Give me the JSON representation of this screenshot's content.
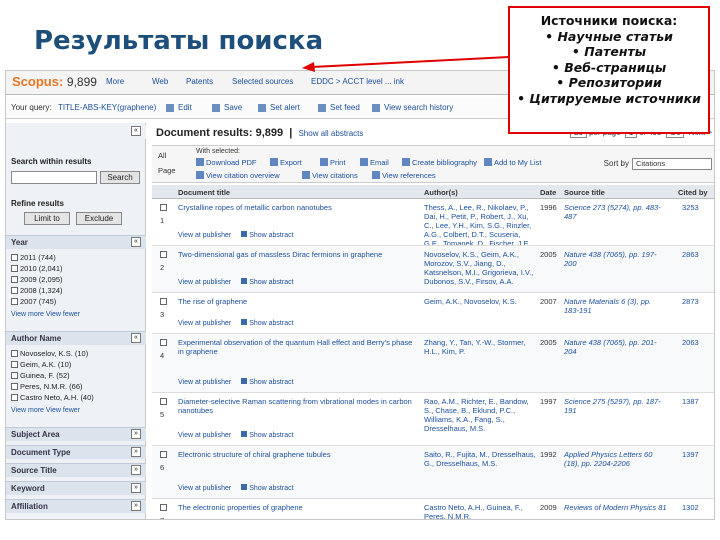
{
  "slide": {
    "title": "Результаты поиска",
    "callout": {
      "heading": "Источники поиска:",
      "items": [
        "• Научные статьи",
        "• Патенты",
        "• Веб-страницы",
        "• Репозитории",
        "• Цитируемые источники"
      ]
    }
  },
  "tabs": {
    "scopus_label": "Scopus:",
    "scopus_count": "9,899",
    "more": "More",
    "web": "Web",
    "patents": "Patents",
    "selected_sources": "Selected sources",
    "custom": "EDDC > ACCT level ... ink"
  },
  "query": {
    "label": "Your query:",
    "text": "TITLE-ABS-KEY(graphene)",
    "edit": "Edit",
    "save": "Save",
    "set_alert": "Set alert",
    "set_feed": "Set feed",
    "history": "View search history"
  },
  "sidebar": {
    "search_within": "Search within results",
    "search_btn": "Search",
    "refine": "Refine results",
    "limit_btn": "Limit to",
    "exclude_btn": "Exclude",
    "year": {
      "head": "Year",
      "items": [
        "2011 (744)",
        "2010 (2,041)",
        "2009 (2,095)",
        "2008 (1,324)",
        "2007 (745)"
      ],
      "more": "View more   View fewer"
    },
    "author": {
      "head": "Author Name",
      "items": [
        "Novoselov, K.S. (10)",
        "Geim, A.K. (10)",
        "Guinea, F. (52)",
        "Peres, N.M.R. (66)",
        "Castro Neto, A.H. (40)"
      ],
      "more": "View more   View fewer"
    },
    "collapsed": [
      "Subject Area",
      "Document Type",
      "Source Title",
      "Keyword",
      "Affiliation"
    ]
  },
  "main": {
    "results_title": "Document results: 9,899",
    "show_abstracts": "Show all abstracts",
    "pager": {
      "per_page": "20",
      "label": "per page",
      "page_box": "1",
      "of": "of 495",
      "go": "Go",
      "next": "Next >"
    },
    "toolbar": {
      "all": "All",
      "page": "Page",
      "with_selected": "With selected:",
      "download": "Download PDF",
      "export": "Export",
      "print": "Print",
      "email": "Email",
      "bibliography": "Create bibliography",
      "add_list": "Add to My List",
      "citation_overview": "View citation overview",
      "view_citations": "View citations",
      "view_refs": "View references",
      "sort_label": "Sort by",
      "sort_value": "Citations"
    },
    "columns": [
      "Document title",
      "Author(s)",
      "Date",
      "Source title",
      "Cited by"
    ],
    "rows": [
      {
        "num": "1",
        "title": "Crystalline ropes of metallic carbon nanotubes",
        "authors": "Thess, A., Lee, R., Nikolaev, P., Dai, H., Petit, P., Robert, J., Xu, C., Lee, Y.H., Kim, S.G., Rinzler, A.G., Colbert, D.T., Scuseria, G.E., Tomanek, D., Fischer, J.E., Smalley, R.E.",
        "date": "1996",
        "source": "Science 273 (5274), pp. 483-487",
        "cited": "3253",
        "view": "View at publisher",
        "abstract": "Show abstract"
      },
      {
        "num": "2",
        "title": "Two-dimensional gas of massless Dirac fermions in graphene",
        "authors": "Novoselov, K.S., Geim, A.K., Morozov, S.V., Jiang, D., Katsnelson, M.I., Grigorieva, I.V., Dubonos, S.V., Firsov, A.A.",
        "date": "2005",
        "source": "Nature 438 (7065), pp. 197-200",
        "cited": "2863",
        "view": "View at publisher",
        "abstract": "Show abstract"
      },
      {
        "num": "3",
        "title": "The rise of graphene",
        "authors": "Geim, A.K., Novoselov, K.S.",
        "date": "2007",
        "source": "Nature Materials 6 (3), pp. 183-191",
        "cited": "2873",
        "view": "View at publisher",
        "abstract": "Show abstract"
      },
      {
        "num": "4",
        "title": "Experimental observation of the quantum Hall effect and Berry's phase in graphene",
        "authors": "Zhang, Y., Tan, Y.-W., Stormer, H.L., Kim, P.",
        "date": "2005",
        "source": "Nature 438 (7065), pp. 201-204",
        "cited": "2063",
        "view": "View at publisher",
        "abstract": "Show abstract"
      },
      {
        "num": "5",
        "title": "Diameter-selective Raman scattering from vibrational modes in carbon nanotubes",
        "authors": "Rao, A.M., Richter, E., Bandow, S., Chase, B., Eklund, P.C., Williams, K.A., Fang, S., Dresselhaus, M.S.",
        "date": "1997",
        "source": "Science 275 (5297), pp. 187-191",
        "cited": "1387",
        "view": "View at publisher",
        "abstract": "Show abstract"
      },
      {
        "num": "6",
        "title": "Electronic structure of chiral graphene tubules",
        "authors": "Saito, R., Fujita, M., Dresselhaus, G., Dresselhaus, M.S.",
        "date": "1992",
        "source": "Applied Physics Letters 60 (18), pp. 2204-2206",
        "cited": "1397",
        "view": "View at publisher",
        "abstract": "Show abstract"
      },
      {
        "num": "7",
        "title": "The electronic properties of graphene",
        "authors": "Castro Neto, A.H., Guinea, F., Peres, N.M.R.",
        "date": "2009",
        "source": "Reviews of Modern Physics 81",
        "cited": "1302",
        "view": "View at publisher",
        "abstract": "Show abstract"
      }
    ]
  }
}
